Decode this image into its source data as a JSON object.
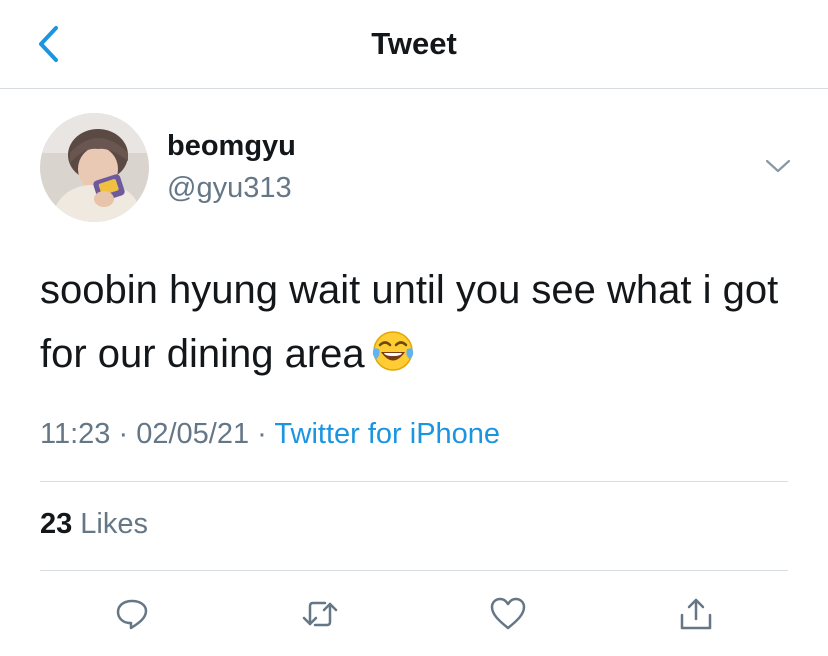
{
  "header": {
    "title": "Tweet",
    "back_icon": "chevron-left-icon",
    "accent_color": "#1b95e0"
  },
  "tweet": {
    "author": {
      "display_name": "beomgyu",
      "handle": "@gyu313"
    },
    "text": "soobin hyung wait until you see what i got for our dining area",
    "emoji": "face-with-tears-of-joy",
    "time": "11:23",
    "separator": "·",
    "date": "02/05/21",
    "source": "Twitter for iPhone",
    "likes_count": "23",
    "likes_label": "Likes"
  },
  "actions": {
    "reply_icon": "reply-icon",
    "retweet_icon": "retweet-icon",
    "like_icon": "heart-icon",
    "share_icon": "share-icon"
  }
}
